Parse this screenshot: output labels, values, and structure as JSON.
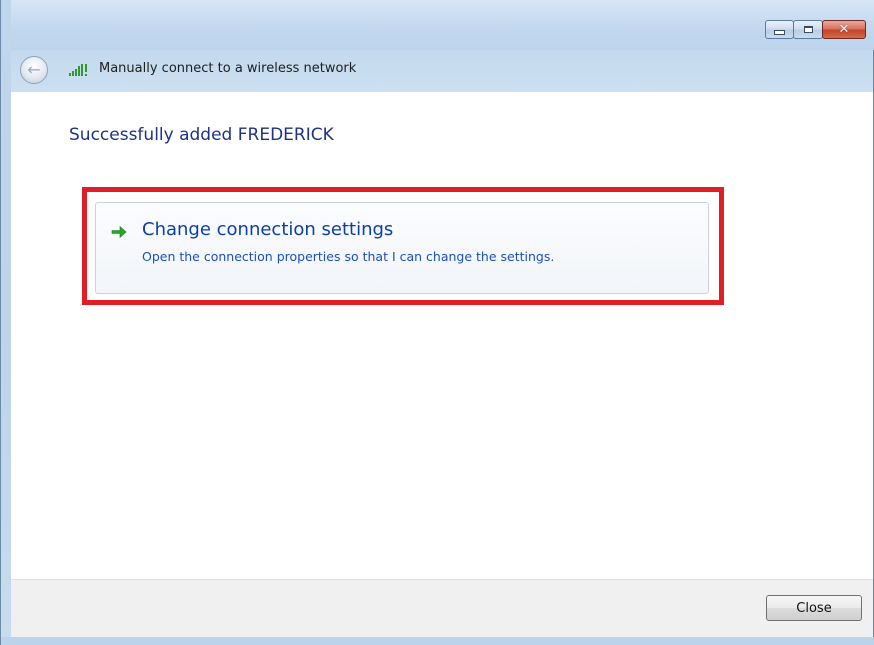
{
  "window": {
    "controls": {
      "minimize_icon": "minimize-icon",
      "maximize_icon": "maximize-icon",
      "close_glyph": "✕"
    }
  },
  "nav": {
    "back_glyph": "←",
    "signal_icon": "wireless-signal-icon",
    "title": "Manually connect to a wireless network"
  },
  "main": {
    "heading": "Successfully added FREDERICK",
    "option": {
      "icon": "green-arrow-icon",
      "title": "Change connection settings",
      "description": "Open the connection properties so that I can change the settings."
    }
  },
  "footer": {
    "close_label": "Close"
  },
  "colors": {
    "highlight_border": "#e01e26",
    "heading": "#1e3287",
    "link_title": "#0b3fa6",
    "link_desc": "#1a50c4"
  }
}
